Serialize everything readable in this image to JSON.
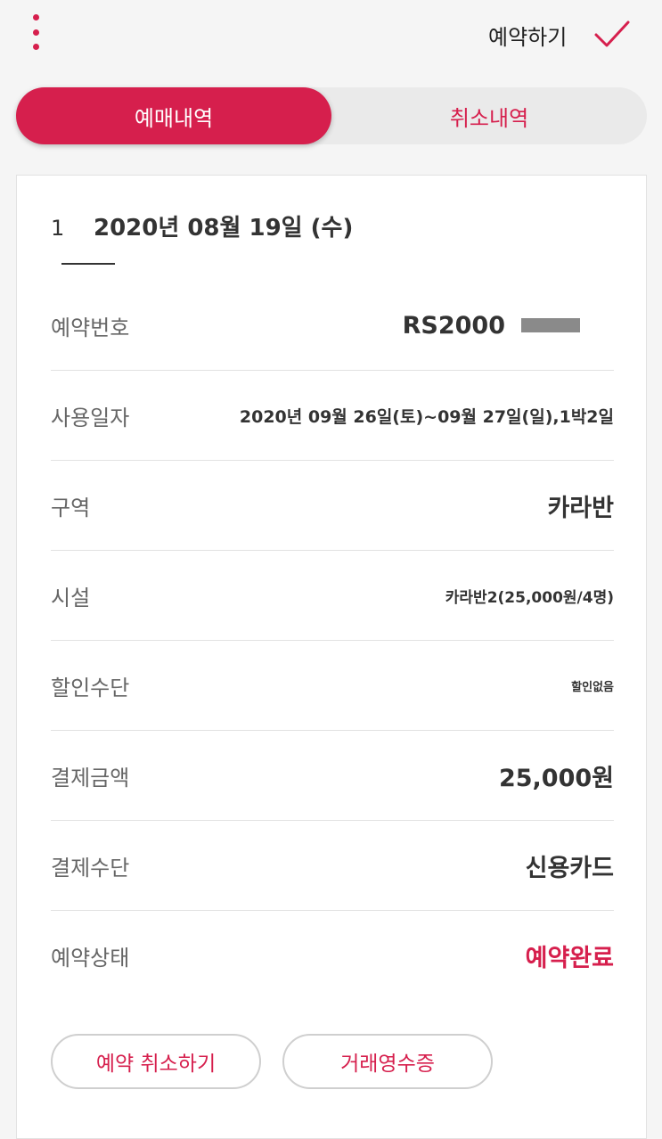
{
  "header": {
    "book_label": "예약하기"
  },
  "tabs": {
    "active": "예매내역",
    "inactive": "취소내역"
  },
  "order": {
    "number": "1",
    "date": "2020년 08월 19일 (수)"
  },
  "details": {
    "reservation_no_label": "예약번호",
    "reservation_no_value": "RS2000",
    "use_date_label": "사용일자",
    "use_date_value": "2020년 09월 26일(토)~09월 27일(일),1박2일",
    "zone_label": "구역",
    "zone_value": "카라반",
    "facility_label": "시설",
    "facility_value": "카라반2(25,000원/4명)",
    "discount_label": "할인수단",
    "discount_value": "할인없음",
    "amount_label": "결제금액",
    "amount_value": "25,000원",
    "payment_label": "결제수단",
    "payment_value": "신용카드",
    "status_label": "예약상태",
    "status_value": "예약완료"
  },
  "buttons": {
    "cancel": "예약 취소하기",
    "receipt": "거래영수증"
  },
  "colors": {
    "accent": "#d61f4d"
  }
}
